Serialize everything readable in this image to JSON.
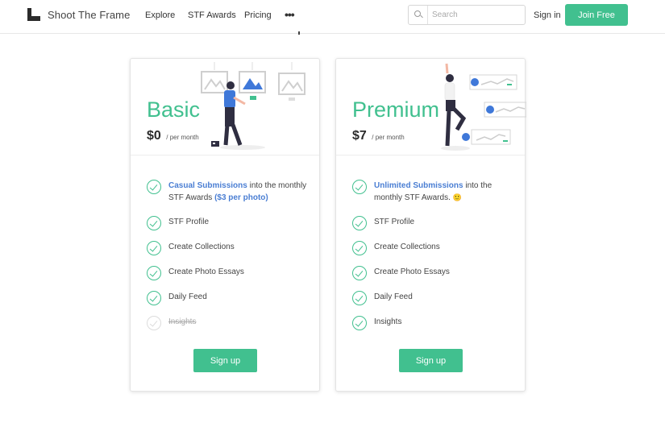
{
  "header": {
    "logo_text": "Shoot The Frame",
    "nav": [
      "Explore",
      "STF Awards",
      "Pricing"
    ],
    "more_label": "•••",
    "search_placeholder": "Search",
    "signin_label": "Sign in",
    "join_label": "Join Free"
  },
  "colors": {
    "accent": "#41c08f",
    "link": "#4a7ed3"
  },
  "plans": {
    "basic": {
      "name": "Basic",
      "price": "$0",
      "period": "/ per month",
      "features": {
        "f1_hl": "Casual Submissions",
        "f1_text": " into the monthly STF Awards ",
        "f1_extra": "($3 per photo)",
        "f2": "STF Profile",
        "f3": "Create Collections",
        "f4": "Create Photo Essays",
        "f5": "Daily Feed",
        "f6": "Insights"
      },
      "signup_label": "Sign up"
    },
    "premium": {
      "name": "Premium",
      "price": "$7",
      "period": "/ per month",
      "features": {
        "f1_hl": "Unlimited Submissions",
        "f1_text": " into the monthly STF Awards. ",
        "f1_emoji": "🙂",
        "f2": "STF Profile",
        "f3": "Create Collections",
        "f4": "Create Photo Essays",
        "f5": "Daily Feed",
        "f6": "Insights"
      },
      "signup_label": "Sign up"
    }
  }
}
